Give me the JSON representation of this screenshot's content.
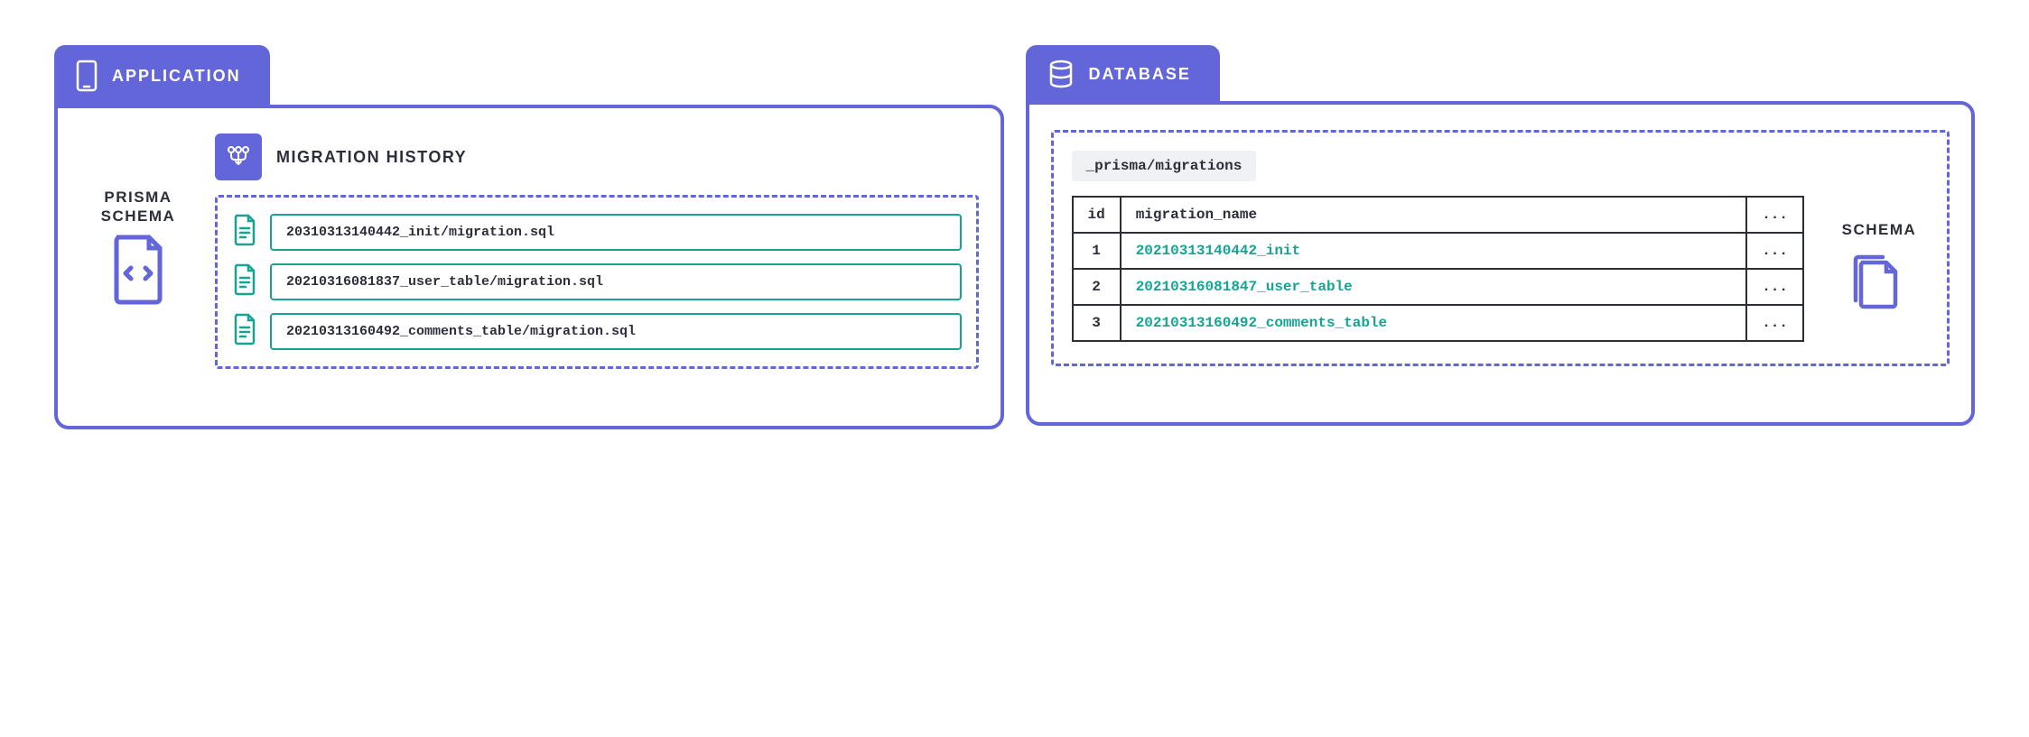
{
  "application": {
    "tab_label": "APPLICATION",
    "schema_label": "PRISMA\nSCHEMA",
    "history_title": "MIGRATION HISTORY",
    "files": [
      "20310313140442_init/migration.sql",
      "20210316081837_user_table/migration.sql",
      "20210313160492_comments_table/migration.sql"
    ]
  },
  "database": {
    "tab_label": "DATABASE",
    "path": "_prisma/migrations",
    "columns": {
      "id": "id",
      "migration_name": "migration_name",
      "dots": "..."
    },
    "rows": [
      {
        "id": "1",
        "name": "20210313140442_init",
        "dots": "..."
      },
      {
        "id": "2",
        "name": "20210316081847_user_table",
        "dots": "..."
      },
      {
        "id": "3",
        "name": "20210313160492_comments_table",
        "dots": "..."
      }
    ],
    "schema_label": "SCHEMA"
  }
}
